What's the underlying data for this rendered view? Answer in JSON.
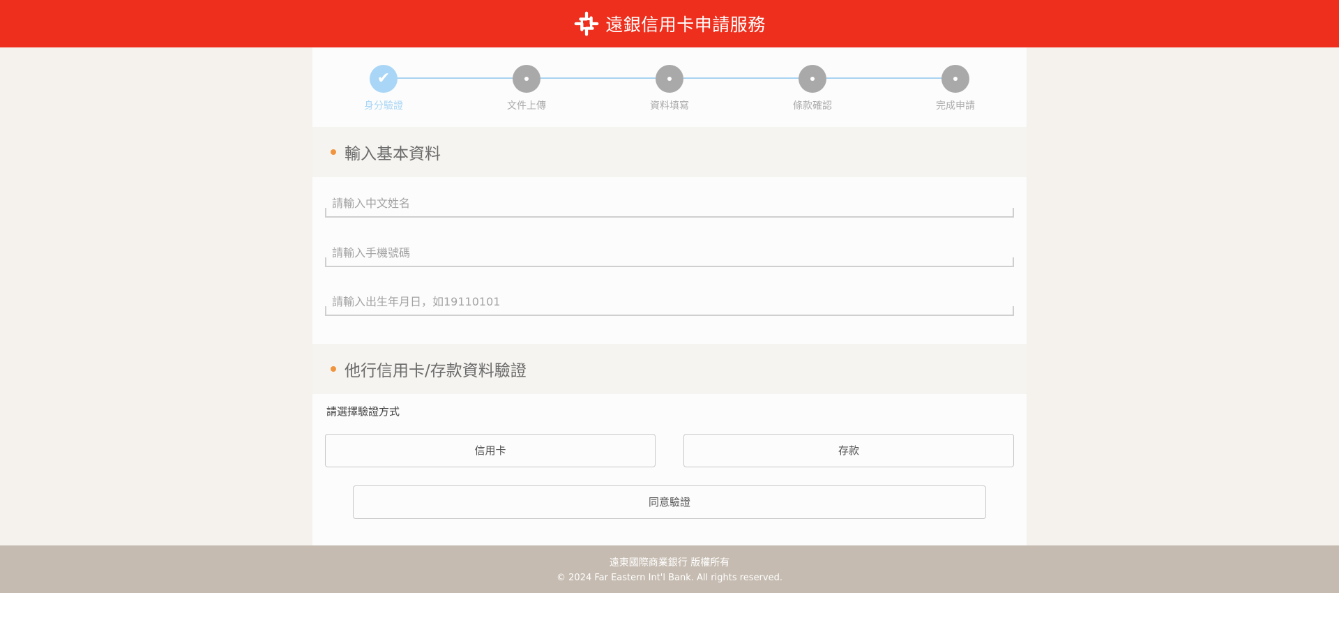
{
  "header": {
    "title": "遠銀信用卡申請服務",
    "logo_icon": "fareastern-knot-logo-icon",
    "brand_color": "#ef2f1d"
  },
  "stepper": {
    "steps": [
      {
        "label": "身分驗證",
        "state": "completed"
      },
      {
        "label": "文件上傳",
        "state": "pending"
      },
      {
        "label": "資料填寫",
        "state": "pending"
      },
      {
        "label": "條款確認",
        "state": "pending"
      },
      {
        "label": "完成申請",
        "state": "pending"
      }
    ],
    "active_color": "#a9d6f6"
  },
  "basic_info": {
    "title": "輸入基本資料",
    "fields": {
      "name_placeholder": "請輸入中文姓名",
      "phone_placeholder": "請輸入手機號碼",
      "birthday_placeholder": "請輸入出生年月日，如19110101"
    }
  },
  "verification": {
    "title": "他行信用卡/存款資料驗證",
    "choose_label": "請選擇驗證方式",
    "options": {
      "credit_card": "信用卡",
      "deposit": "存款"
    },
    "agree_button": "同意驗證"
  },
  "footer": {
    "line1": "遠東國際商業銀行 版權所有",
    "line2": "© 2024 Far Eastern Int'l Bank. All rights reserved."
  }
}
